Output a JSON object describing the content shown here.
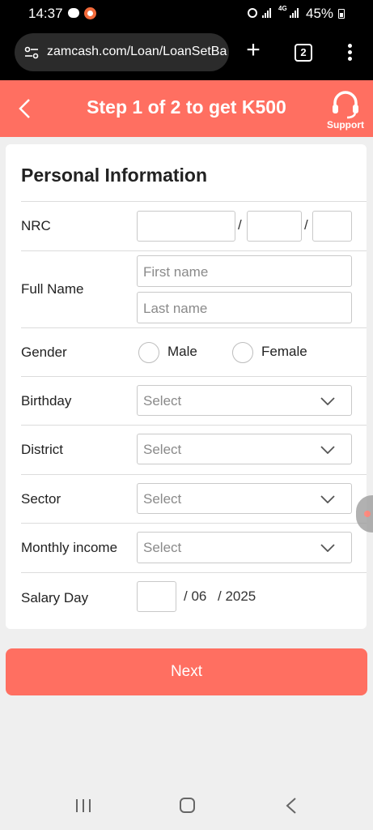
{
  "status_bar": {
    "time": "14:37",
    "network": "4G",
    "battery": "45%"
  },
  "browser": {
    "url": "zamcash.com/Loan/LoanSetBa",
    "tab_count": "2"
  },
  "header": {
    "title": "Step 1 of 2 to get K500",
    "support_label": "Support"
  },
  "form": {
    "section_title": "Personal Information",
    "nrc": {
      "label": "NRC",
      "separator": "/"
    },
    "full_name": {
      "label": "Full Name",
      "first_placeholder": "First name",
      "last_placeholder": "Last name"
    },
    "gender": {
      "label": "Gender",
      "options": [
        "Male",
        "Female"
      ]
    },
    "birthday": {
      "label": "Birthday",
      "value": "Select"
    },
    "district": {
      "label": "District",
      "value": "Select"
    },
    "sector": {
      "label": "Sector",
      "value": "Select"
    },
    "monthly_income": {
      "label": "Monthly income",
      "value": "Select"
    },
    "salary_day": {
      "label": "Salary Day",
      "month": "/ 06",
      "year": "/ 2025"
    }
  },
  "next_button": {
    "label": "Next"
  },
  "colors": {
    "accent": "#ff6f61",
    "background": "#efefef"
  }
}
